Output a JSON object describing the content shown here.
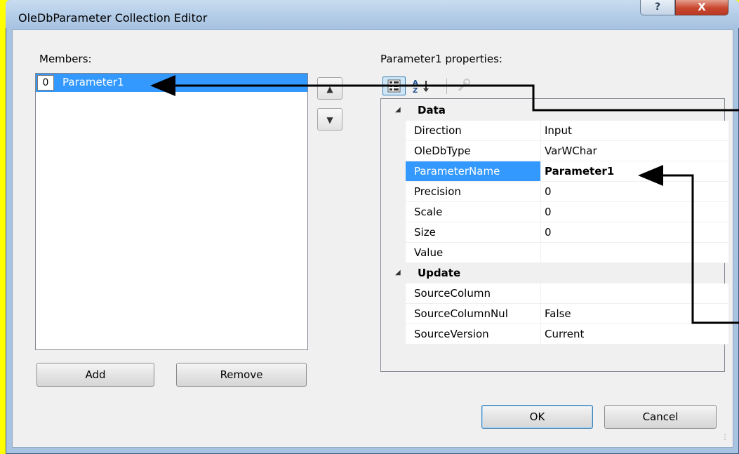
{
  "window": {
    "title": "OleDbParameter Collection Editor",
    "help_glyph": "?",
    "close_glyph": "X"
  },
  "members": {
    "label": "Members:",
    "items": [
      {
        "index": "0",
        "name": "Parameter1",
        "selected": true
      }
    ],
    "move_up_icon": "arrow-up",
    "move_down_icon": "arrow-down",
    "add_label": "Add",
    "remove_label": "Remove"
  },
  "properties": {
    "label": "Parameter1 properties:",
    "toolbar": [
      "categorized-icon",
      "alphabetical-icon",
      "property-pages-icon"
    ],
    "categories": [
      {
        "name": "Data",
        "rows": [
          {
            "name": "Direction",
            "value": "Input"
          },
          {
            "name": "OleDbType",
            "value": "VarWChar"
          },
          {
            "name": "ParameterName",
            "value": "Parameter1",
            "selected": true,
            "bold": true
          },
          {
            "name": "Precision",
            "value": "0"
          },
          {
            "name": "Scale",
            "value": "0"
          },
          {
            "name": "Size",
            "value": "0"
          },
          {
            "name": "Value",
            "value": ""
          }
        ]
      },
      {
        "name": "Update",
        "rows": [
          {
            "name": "SourceColumn",
            "value": ""
          },
          {
            "name": "SourceColumnNul",
            "value": "False"
          },
          {
            "name": "SourceVersion",
            "value": "Current"
          }
        ]
      }
    ]
  },
  "footer": {
    "ok_label": "OK",
    "cancel_label": "Cancel"
  },
  "colors": {
    "annotation_background": "#ffff00",
    "selection": "#3399ff",
    "annotation_arrows": "#000000"
  }
}
